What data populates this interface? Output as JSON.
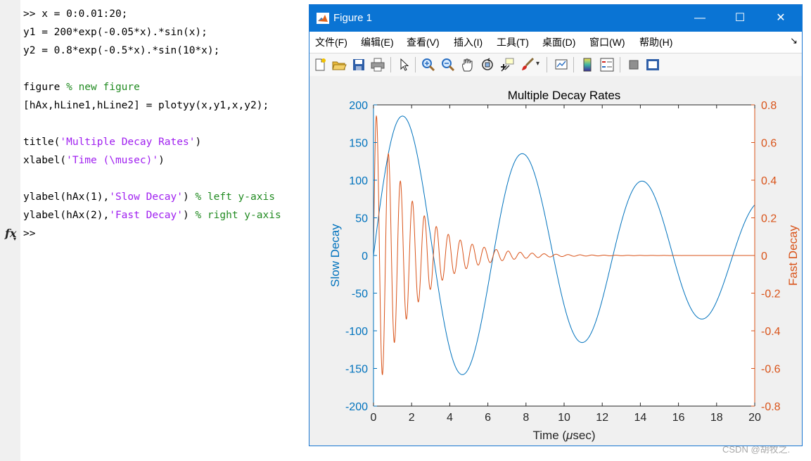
{
  "command_window": {
    "lines": [
      [
        {
          "t": ">> x = 0:0.01:20;",
          "c": "plain"
        }
      ],
      [
        {
          "t": "y1 = 200*exp(-0.05*x).*sin(x);",
          "c": "plain"
        }
      ],
      [
        {
          "t": "y2 = 0.8*exp(-0.5*x).*sin(10*x);",
          "c": "plain"
        }
      ],
      [],
      [
        {
          "t": "figure ",
          "c": "plain"
        },
        {
          "t": "% new figure",
          "c": "comment"
        }
      ],
      [
        {
          "t": "[hAx,hLine1,hLine2] = plotyy(x,y1,x,y2);",
          "c": "plain"
        }
      ],
      [],
      [
        {
          "t": "title(",
          "c": "plain"
        },
        {
          "t": "'Multiple Decay Rates'",
          "c": "string"
        },
        {
          "t": ")",
          "c": "plain"
        }
      ],
      [
        {
          "t": "xlabel(",
          "c": "plain"
        },
        {
          "t": "'Time (\\musec)'",
          "c": "string"
        },
        {
          "t": ")",
          "c": "plain"
        }
      ],
      [],
      [
        {
          "t": "ylabel(hAx(1),",
          "c": "plain"
        },
        {
          "t": "'Slow Decay'",
          "c": "string"
        },
        {
          "t": ") ",
          "c": "plain"
        },
        {
          "t": "% left y-axis",
          "c": "comment"
        }
      ],
      [
        {
          "t": "ylabel(hAx(2),",
          "c": "plain"
        },
        {
          "t": "'Fast Decay'",
          "c": "string"
        },
        {
          "t": ") ",
          "c": "plain"
        },
        {
          "t": "% right y-axis",
          "c": "comment"
        }
      ],
      [
        {
          "t": ">>",
          "c": "plain"
        }
      ]
    ],
    "fx_label": "fx",
    "watermark": "CSDN @胡牧之."
  },
  "figure": {
    "title": "Figure 1",
    "window_buttons": {
      "minimize": "—",
      "maximize": "☐",
      "close": "✕"
    },
    "menu": [
      "文件(F)",
      "编辑(E)",
      "查看(V)",
      "插入(I)",
      "工具(T)",
      "桌面(D)",
      "窗口(W)",
      "帮助(H)"
    ],
    "menu_overflow": "↘",
    "toolbar_icons": [
      "new-figure-icon",
      "open-file-icon",
      "save-icon",
      "print-icon",
      "pointer-icon",
      "zoom-in-icon",
      "zoom-out-icon",
      "pan-hand-icon",
      "rotate-3d-icon",
      "data-cursor-icon",
      "brush-icon",
      "link-plot-icon",
      "colorbar-icon",
      "legend-icon",
      "hide-plot-tools-icon",
      "show-plot-tools-icon"
    ]
  },
  "chart_data": {
    "type": "line",
    "title": "Multiple Decay Rates",
    "xlabel": "Time (μsec)",
    "xlabel_parts": [
      "Time (",
      "μ",
      "sec)"
    ],
    "ylabel_left": "Slow Decay",
    "ylabel_right": "Fast Decay",
    "xlim": [
      0,
      20
    ],
    "ylim_left": [
      -200,
      200
    ],
    "ylim_right": [
      -0.8,
      0.8
    ],
    "x_ticks": [
      "0",
      "2",
      "4",
      "6",
      "8",
      "10",
      "12",
      "14",
      "16",
      "18",
      "20"
    ],
    "y_ticks_left": [
      "-200",
      "-150",
      "-100",
      "-50",
      "0",
      "50",
      "100",
      "150",
      "200"
    ],
    "y_ticks_right": [
      "-0.8",
      "-0.6",
      "-0.4",
      "-0.2",
      "0",
      "0.2",
      "0.4",
      "0.6",
      "0.8"
    ],
    "grid": false,
    "series": [
      {
        "axis": "left",
        "color": "#0072bd",
        "formula": "200*exp(-0.05*x).*sin(x)",
        "x_range": [
          0,
          20
        ],
        "step": 0.01
      },
      {
        "axis": "right",
        "color": "#d95319",
        "formula": "0.8*exp(-0.5*x).*sin(10*x)",
        "x_range": [
          0,
          20
        ],
        "step": 0.01
      }
    ]
  },
  "colors": {
    "left_axis": "#0072bd",
    "right_axis": "#d95319",
    "titlebar": "#0a74d4",
    "string": "#a020f0",
    "comment": "#228b22"
  }
}
